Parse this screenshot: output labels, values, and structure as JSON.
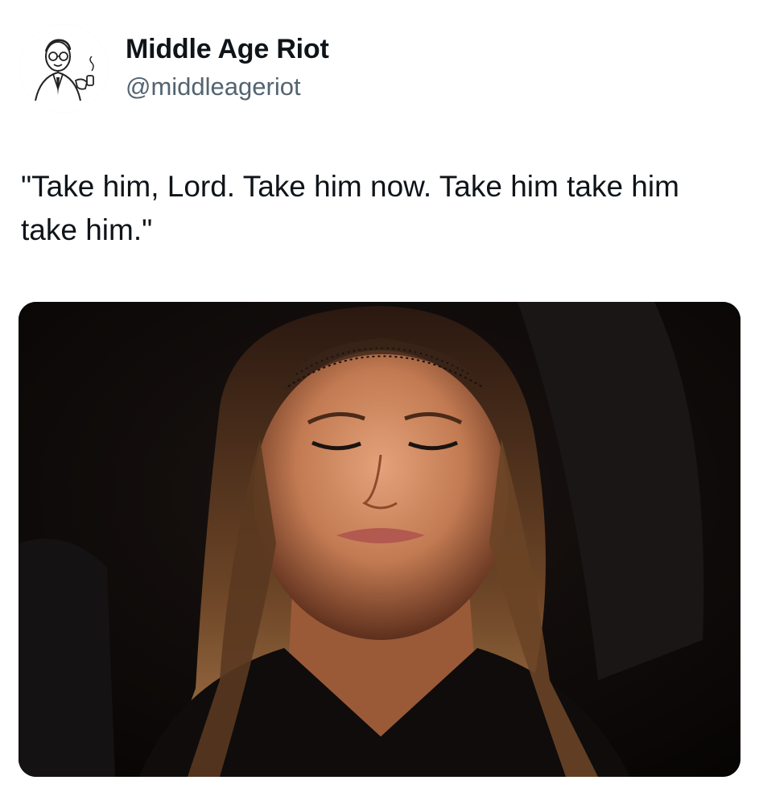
{
  "author": {
    "name": "Middle Age Riot",
    "handle": "@middleageriot",
    "avatar_icon": "retro-cartoon-man-with-pipe-avatar"
  },
  "tweet": {
    "text": "\"Take him, Lord. Take him now. Take him take him take him.\""
  },
  "media": {
    "description_icon": "photo-woman-eyes-closed-black-lace-veil",
    "background_color": "#0c0908"
  }
}
